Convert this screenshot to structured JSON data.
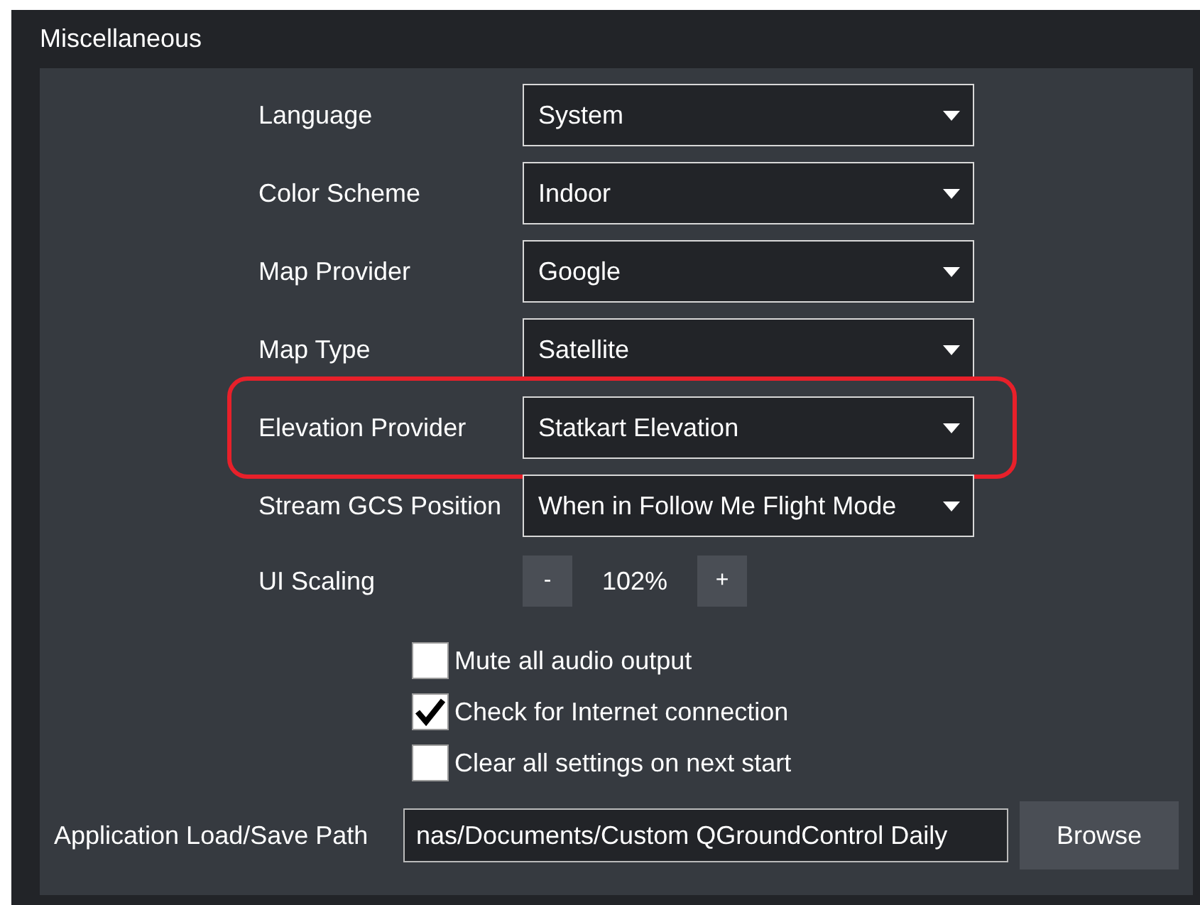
{
  "section": {
    "title": "Miscellaneous"
  },
  "settings": [
    {
      "label": "Language",
      "value": "System",
      "highlighted": false
    },
    {
      "label": "Color Scheme",
      "value": "Indoor",
      "highlighted": false
    },
    {
      "label": "Map Provider",
      "value": "Google",
      "highlighted": false
    },
    {
      "label": "Map Type",
      "value": "Satellite",
      "highlighted": false
    },
    {
      "label": "Elevation Provider",
      "value": "Statkart Elevation",
      "highlighted": true
    },
    {
      "label": "Stream GCS Position",
      "value": "When in Follow Me Flight Mode",
      "highlighted": false
    }
  ],
  "scaling": {
    "label": "UI Scaling",
    "decrease": "-",
    "value": "102%",
    "increase": "+"
  },
  "checkboxes": [
    {
      "label": "Mute all audio output",
      "checked": false
    },
    {
      "label": "Check for Internet connection",
      "checked": true
    },
    {
      "label": "Clear all settings on next start",
      "checked": false
    }
  ],
  "path": {
    "label": "Application Load/Save Path",
    "value": "nas/Documents/Custom QGroundControl Daily",
    "button": "Browse"
  }
}
